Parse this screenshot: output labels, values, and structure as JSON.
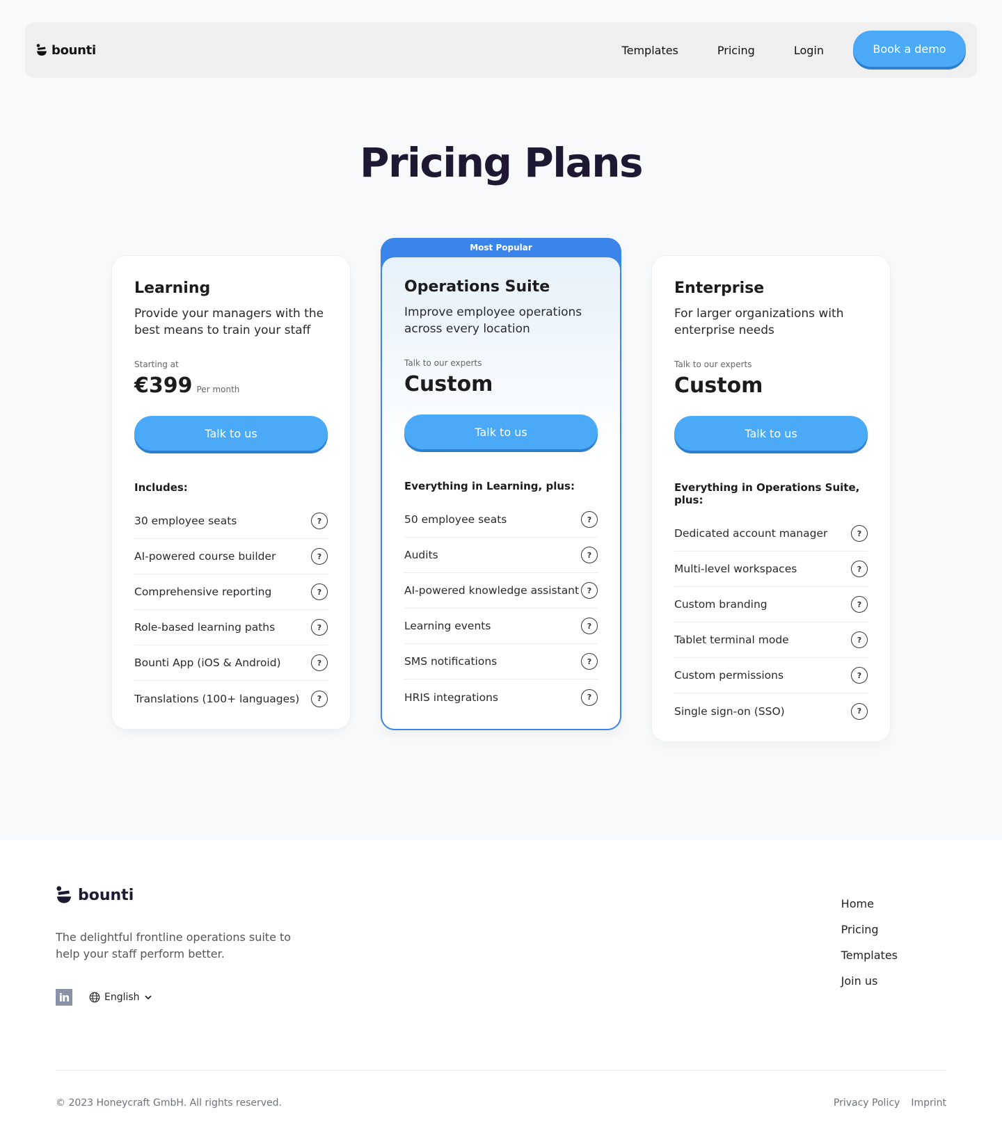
{
  "nav": {
    "logo_text": "bounti",
    "links": [
      "Templates",
      "Pricing",
      "Login"
    ],
    "cta": "Book a demo"
  },
  "page_title": "Pricing Plans",
  "colors": {
    "accent": "#4aaaf8",
    "accent_shadow": "#2f7fd0",
    "popular": "#3a84ea",
    "title": "#1e1833"
  },
  "plans": [
    {
      "name": "Learning",
      "description": "Provide your managers with the best means to train your staff",
      "price_label": "Starting at",
      "price": "€399",
      "price_unit": "Per month",
      "cta": "Talk to us",
      "includes_label": "Includes:",
      "features": [
        "30 employee seats",
        "AI-powered course builder",
        "Comprehensive reporting",
        "Role-based learning paths",
        "Bounti App (iOS & Android)",
        "Translations (100+ languages)"
      ]
    },
    {
      "badge": "Most Popular",
      "name": "Operations Suite",
      "description": "Improve employee operations across every location",
      "price_label": "Talk to our experts",
      "price": "Custom",
      "price_unit": "",
      "cta": "Talk to us",
      "includes_label": "Everything in Learning, plus:",
      "features": [
        "50 employee seats",
        "Audits",
        "AI-powered knowledge assistant",
        "Learning events",
        "SMS notifications",
        "HRIS integrations"
      ]
    },
    {
      "name": "Enterprise",
      "description": "For larger organizations with enterprise needs",
      "price_label": "Talk to our experts",
      "price": "Custom",
      "price_unit": "",
      "cta": "Talk to us",
      "includes_label": "Everything in Operations Suite, plus:",
      "features": [
        "Dedicated account manager",
        "Multi-level workspaces",
        "Custom branding",
        "Tablet terminal mode",
        "Custom permissions",
        "Single sign-on (SSO)"
      ]
    }
  ],
  "help_icon_glyph": "?",
  "footer": {
    "logo_text": "bounti",
    "tagline": "The delightful frontline operations suite to help your staff perform better.",
    "linkedin_label": "in",
    "language": "English",
    "links": [
      "Home",
      "Pricing",
      "Templates",
      "Join us"
    ],
    "copyright": "© 2023 Honeycraft GmbH. All rights reserved.",
    "legal_links": [
      "Privacy Policy",
      "Imprint"
    ]
  }
}
